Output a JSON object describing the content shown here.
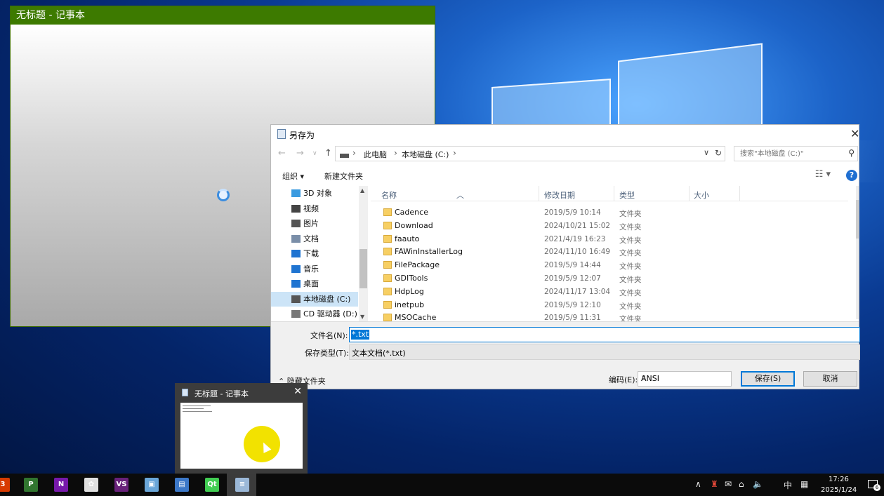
{
  "notepad": {
    "title": "无标题 - 记事本"
  },
  "dialog": {
    "title": "另存为",
    "breadcrumb": [
      "此电脑",
      "本地磁盘 (C:)"
    ],
    "search_placeholder": "搜索\"本地磁盘 (C:)\"",
    "toolbar": {
      "organize": "组织 ▾",
      "new_folder": "新建文件夹"
    },
    "nav_items": [
      {
        "label": "3D 对象",
        "icon": "cube-icon",
        "color": "#3b9be0"
      },
      {
        "label": "视频",
        "icon": "video-icon",
        "color": "#444444"
      },
      {
        "label": "图片",
        "icon": "pictures-icon",
        "color": "#555555"
      },
      {
        "label": "文档",
        "icon": "documents-icon",
        "color": "#7a8ea8"
      },
      {
        "label": "下载",
        "icon": "download-icon",
        "color": "#1f74d1"
      },
      {
        "label": "音乐",
        "icon": "music-icon",
        "color": "#1f74d1"
      },
      {
        "label": "桌面",
        "icon": "desktop-icon",
        "color": "#1f74d1"
      },
      {
        "label": "本地磁盘 (C:)",
        "icon": "drive-icon",
        "color": "#555555",
        "selected": true
      },
      {
        "label": "CD 驱动器 (D:) ∨",
        "icon": "cd-drive-icon",
        "color": "#777777"
      }
    ],
    "columns": {
      "name": "名称",
      "date": "修改日期",
      "type": "类型",
      "size": "大小"
    },
    "files": [
      {
        "name": "Cadence",
        "date": "2019/5/9 10:14",
        "type": "文件夹"
      },
      {
        "name": "Download",
        "date": "2024/10/21 15:02",
        "type": "文件夹"
      },
      {
        "name": "faauto",
        "date": "2021/4/19 16:23",
        "type": "文件夹"
      },
      {
        "name": "FAWinInstallerLog",
        "date": "2024/11/10 16:49",
        "type": "文件夹"
      },
      {
        "name": "FilePackage",
        "date": "2019/5/9 14:44",
        "type": "文件夹"
      },
      {
        "name": "GDITools",
        "date": "2019/5/9 12:07",
        "type": "文件夹"
      },
      {
        "name": "HdpLog",
        "date": "2024/11/17 13:04",
        "type": "文件夹"
      },
      {
        "name": "inetpub",
        "date": "2019/5/9 12:10",
        "type": "文件夹"
      },
      {
        "name": "MSOCache",
        "date": "2019/5/9 11:31",
        "type": "文件夹"
      }
    ],
    "filename_label": "文件名(N):",
    "filename_value": "*.txt",
    "filetype_label": "保存类型(T):",
    "filetype_value": "文本文档(*.txt)",
    "hide_folders": "隐藏文件夹",
    "encoding_label": "编码(E):",
    "encoding_value": "ANSI",
    "save_button": "保存(S)",
    "cancel_button": "取消"
  },
  "thumbnail": {
    "title": "无标题 - 记事本"
  },
  "taskbar": {
    "apps": [
      {
        "icon": "office-icon",
        "glyph": "3",
        "color": "#d83b01"
      },
      {
        "icon": "project-icon",
        "glyph": "P",
        "color": "#31752f"
      },
      {
        "icon": "onenote-icon",
        "glyph": "N",
        "color": "#7719aa"
      },
      {
        "icon": "paint-icon",
        "glyph": "✿",
        "color": "#e0e0e0"
      },
      {
        "icon": "visual-studio-icon",
        "glyph": "VS",
        "color": "#68217a"
      },
      {
        "icon": "image-viewer-icon",
        "glyph": "▣",
        "color": "#6aa6d8"
      },
      {
        "icon": "network-tool-icon",
        "glyph": "▤",
        "color": "#3c78c8"
      },
      {
        "icon": "qt-icon",
        "glyph": "Qt",
        "color": "#41cd52"
      },
      {
        "icon": "notepad-icon",
        "glyph": "≡",
        "color": "#9bb8d8"
      }
    ],
    "ime": "中",
    "time": "17:26",
    "date": "2025/1/24",
    "notification_count": "6"
  }
}
